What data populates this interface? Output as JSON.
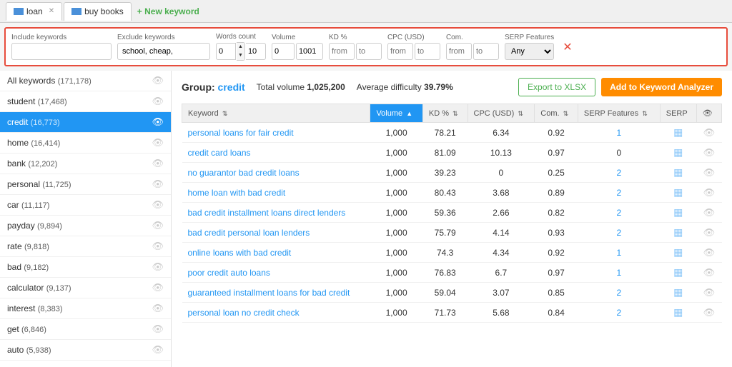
{
  "tabs": [
    {
      "id": "loan",
      "label": "loan",
      "active": true,
      "closable": true
    },
    {
      "id": "buy-books",
      "label": "buy books",
      "active": false,
      "closable": false
    }
  ],
  "new_keyword_label": "+ New keyword",
  "filter": {
    "include_label": "Include keywords",
    "exclude_label": "Exclude keywords",
    "exclude_value": "school, cheap,",
    "words_label": "Words count",
    "words_from": "0",
    "words_to": "10",
    "volume_label": "Volume",
    "volume_from": "0",
    "volume_to": "1001",
    "kd_label": "KD %",
    "kd_from": "from",
    "kd_to": "to",
    "cpc_label": "CPC (USD)",
    "cpc_from": "from",
    "cpc_to": "to",
    "com_label": "Com.",
    "com_from": "from",
    "com_to": "to",
    "serp_label": "SERP Features",
    "serp_value": "Any"
  },
  "sidebar": {
    "items": [
      {
        "label": "All keywords",
        "count": "(171,178)",
        "active": false
      },
      {
        "label": "student",
        "count": "(17,468)",
        "active": false
      },
      {
        "label": "credit",
        "count": "(16,773)",
        "active": true
      },
      {
        "label": "home",
        "count": "(16,414)",
        "active": false
      },
      {
        "label": "bank",
        "count": "(12,202)",
        "active": false
      },
      {
        "label": "personal",
        "count": "(11,725)",
        "active": false
      },
      {
        "label": "car",
        "count": "(11,117)",
        "active": false
      },
      {
        "label": "payday",
        "count": "(9,894)",
        "active": false
      },
      {
        "label": "rate",
        "count": "(9,818)",
        "active": false
      },
      {
        "label": "bad",
        "count": "(9,182)",
        "active": false
      },
      {
        "label": "calculator",
        "count": "(9,137)",
        "active": false
      },
      {
        "label": "interest",
        "count": "(8,383)",
        "active": false
      },
      {
        "label": "get",
        "count": "(6,846)",
        "active": false
      },
      {
        "label": "auto",
        "count": "(5,938)",
        "active": false
      }
    ]
  },
  "group": {
    "title": "credit",
    "total_volume_label": "Total volume",
    "total_volume": "1,025,200",
    "avg_difficulty_label": "Average difficulty",
    "avg_difficulty": "39.79%",
    "export_label": "Export to XLSX",
    "add_label": "Add to Keyword Analyzer"
  },
  "table": {
    "columns": [
      "Keyword",
      "Volume",
      "KD %",
      "CPC (USD)",
      "Com.",
      "SERP Features",
      "SERP",
      ""
    ],
    "rows": [
      {
        "keyword": "personal loans for fair credit",
        "volume": "1,000",
        "kd": "78.21",
        "cpc": "6.34",
        "com": "0.92",
        "serp_features": "1",
        "has_serp": true
      },
      {
        "keyword": "credit card loans",
        "volume": "1,000",
        "kd": "81.09",
        "cpc": "10.13",
        "com": "0.97",
        "serp_features": "0",
        "has_serp": true
      },
      {
        "keyword": "no guarantor bad credit loans",
        "volume": "1,000",
        "kd": "39.23",
        "cpc": "0",
        "com": "0.25",
        "serp_features": "2",
        "has_serp": true
      },
      {
        "keyword": "home loan with bad credit",
        "volume": "1,000",
        "kd": "80.43",
        "cpc": "3.68",
        "com": "0.89",
        "serp_features": "2",
        "has_serp": true
      },
      {
        "keyword": "bad credit installment loans direct lenders",
        "volume": "1,000",
        "kd": "59.36",
        "cpc": "2.66",
        "com": "0.82",
        "serp_features": "2",
        "has_serp": true
      },
      {
        "keyword": "bad credit personal loan lenders",
        "volume": "1,000",
        "kd": "75.79",
        "cpc": "4.14",
        "com": "0.93",
        "serp_features": "2",
        "has_serp": true
      },
      {
        "keyword": "online loans with bad credit",
        "volume": "1,000",
        "kd": "74.3",
        "cpc": "4.34",
        "com": "0.92",
        "serp_features": "1",
        "has_serp": true
      },
      {
        "keyword": "poor credit auto loans",
        "volume": "1,000",
        "kd": "76.83",
        "cpc": "6.7",
        "com": "0.97",
        "serp_features": "1",
        "has_serp": true
      },
      {
        "keyword": "guaranteed installment loans for bad credit",
        "volume": "1,000",
        "kd": "59.04",
        "cpc": "3.07",
        "com": "0.85",
        "serp_features": "2",
        "has_serp": true
      },
      {
        "keyword": "personal loan no credit check",
        "volume": "1,000",
        "kd": "71.73",
        "cpc": "5.68",
        "com": "0.84",
        "serp_features": "2",
        "has_serp": true
      }
    ]
  }
}
